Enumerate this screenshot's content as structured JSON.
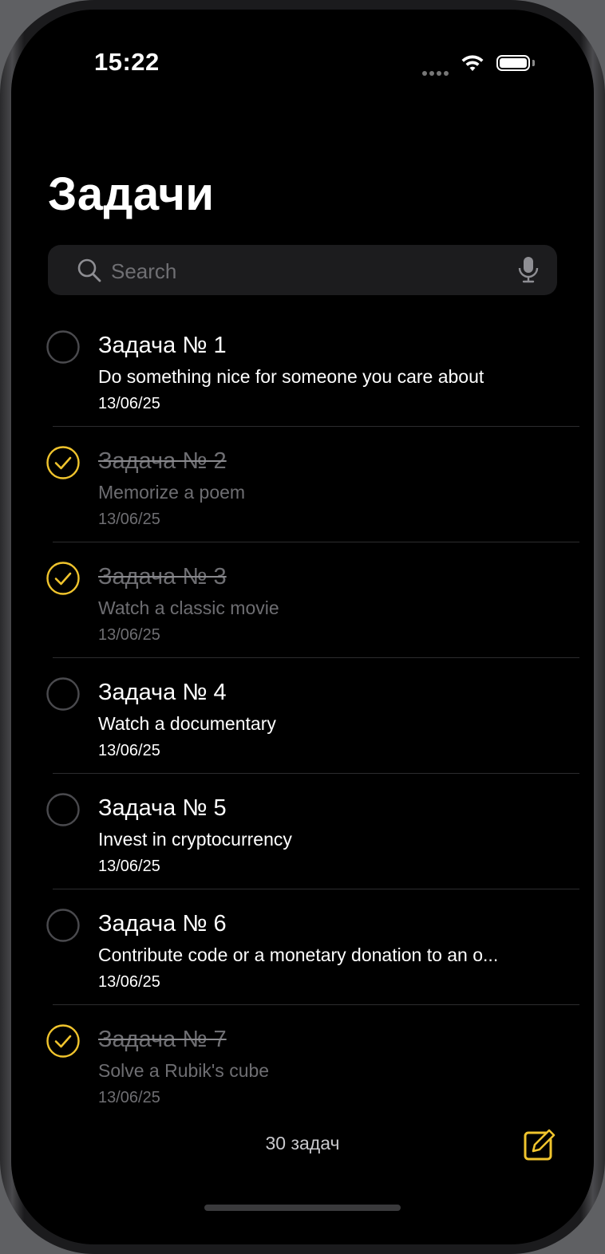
{
  "status": {
    "time": "15:22"
  },
  "title": "Задачи",
  "search": {
    "placeholder": "Search"
  },
  "tasks": [
    {
      "title": "Задача № 1",
      "description": "Do something nice for someone you care about",
      "date": "13/06/25",
      "done": false
    },
    {
      "title": "Задача № 2",
      "description": "Memorize a poem",
      "date": "13/06/25",
      "done": true
    },
    {
      "title": "Задача № 3",
      "description": "Watch a classic movie",
      "date": "13/06/25",
      "done": true
    },
    {
      "title": "Задача № 4",
      "description": "Watch a documentary",
      "date": "13/06/25",
      "done": false
    },
    {
      "title": "Задача № 5",
      "description": "Invest in cryptocurrency",
      "date": "13/06/25",
      "done": false
    },
    {
      "title": "Задача № 6",
      "description": "Contribute code or a monetary donation to an o...",
      "date": "13/06/25",
      "done": false
    },
    {
      "title": "Задача № 7",
      "description": "Solve a Rubik's cube",
      "date": "13/06/25",
      "done": true
    }
  ],
  "footer": {
    "count": "30 задач"
  },
  "colors": {
    "accent": "#f0c42d",
    "background": "#000000",
    "muted": "#6e6e72"
  },
  "icons": {
    "search": "search-icon",
    "mic": "mic-icon",
    "compose": "compose-icon",
    "check": "checkmark-icon"
  }
}
